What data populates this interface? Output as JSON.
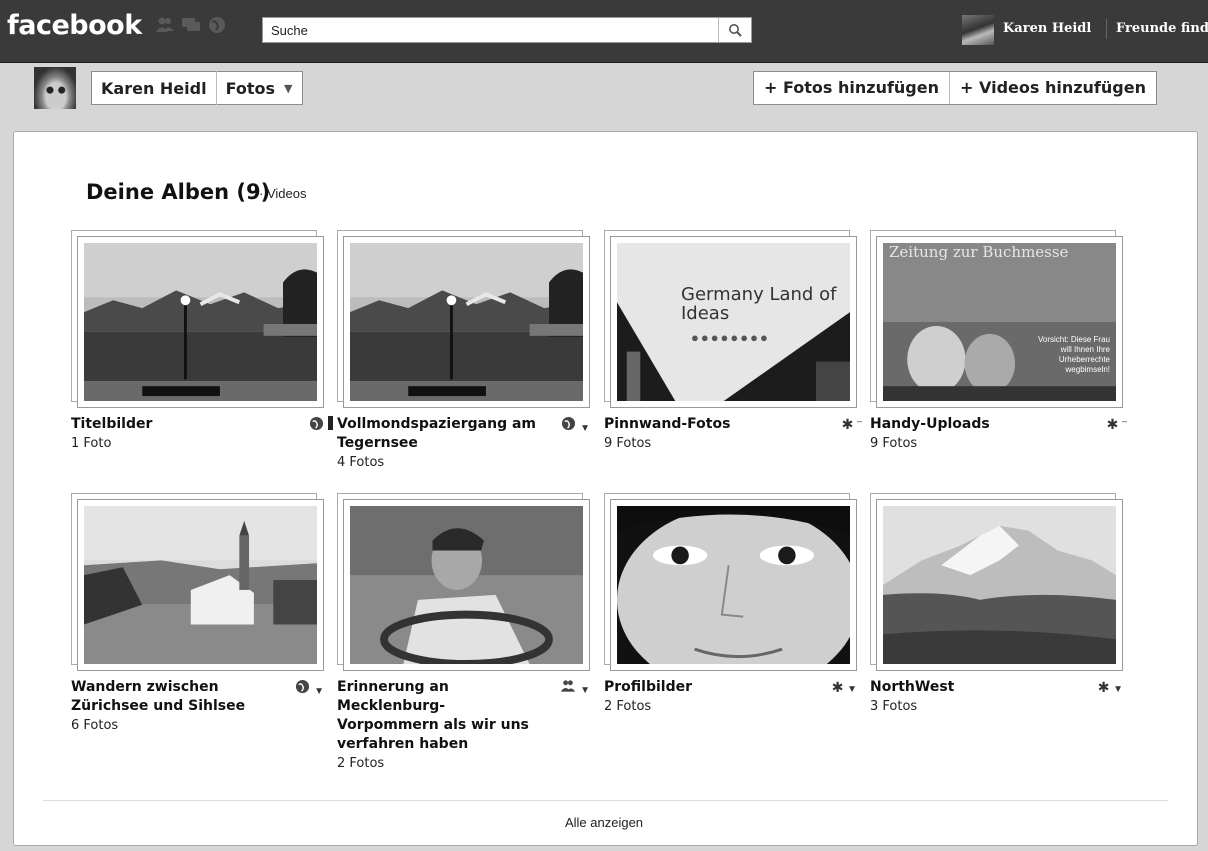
{
  "topbar": {
    "logo": "facebook",
    "search_placeholder": "Suche",
    "username": "Karen Heidl",
    "friends_link": "Freunde finden"
  },
  "header": {
    "breadcrumb_user": "Karen Heidl",
    "breadcrumb_section": "Fotos",
    "add_photos": "+ Fotos hinzufügen",
    "add_videos": "+ Videos hinzufügen"
  },
  "albums_section": {
    "title": "Deine Alben (9)",
    "videos_link": "· Videos",
    "albums": [
      {
        "name": "Titelbilder",
        "count": "1 Foto",
        "privacy_icon": "globe-icon"
      },
      {
        "name": "Vollmondspaziergang am Tegernsee",
        "count": "4 Fotos",
        "privacy_icon": "globe-icon"
      },
      {
        "name": "Pinnwand-Fotos",
        "count": "9 Fotos",
        "privacy_icon": "gear-icon",
        "photo_text": "Germany Land of Ideas"
      },
      {
        "name": "Handy-Uploads",
        "count": "9 Fotos",
        "privacy_icon": "gear-icon",
        "photo_text": "Zeitung zur Buchmesse",
        "photo_caption": "Vorsicht: Diese Frau will Ihnen Ihre Urheberrechte wegbimseln!"
      },
      {
        "name": "Wandern zwischen Zürichsee und Sihlsee",
        "count": "6 Fotos",
        "privacy_icon": "globe-icon"
      },
      {
        "name": "Erinnerung an Mecklenburg-Vorpommern als wir uns verfahren haben",
        "count": "2 Fotos",
        "privacy_icon": "friends-icon"
      },
      {
        "name": "Profilbilder",
        "count": "2 Fotos",
        "privacy_icon": "gear-icon"
      },
      {
        "name": "NorthWest",
        "count": "3 Fotos",
        "privacy_icon": "gear-icon"
      }
    ],
    "show_all": "Alle anzeigen"
  }
}
